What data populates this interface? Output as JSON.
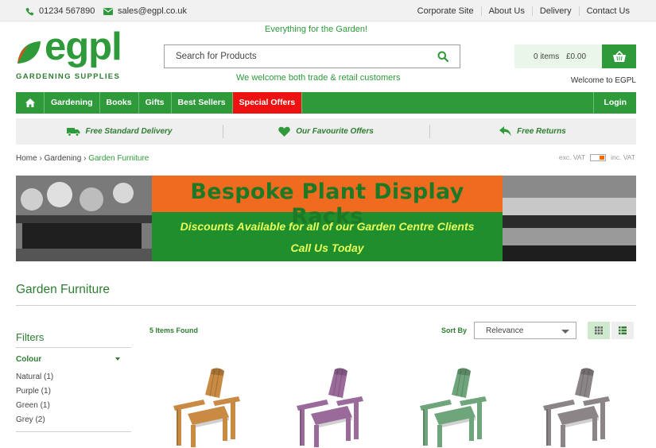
{
  "topbar": {
    "phone": "01234 567890",
    "email": "sales@egpl.co.uk",
    "links": [
      "Corporate Site",
      "About Us",
      "Delivery",
      "Contact Us"
    ]
  },
  "header": {
    "logo_text": "egpl",
    "logo_sub": "GARDENING SUPPLIES",
    "tagline": "Everything for the Garden!",
    "search_placeholder": "Search for Products",
    "welcome_trade": "We welcome both trade & retail customers",
    "basket_items": "0 items",
    "basket_total": "£0.00",
    "welcome_user": "Welcome to EGPL"
  },
  "nav": {
    "items": [
      "Gardening",
      "Books",
      "Gifts",
      "Best Sellers",
      "Special Offers"
    ],
    "login": "Login"
  },
  "usp": [
    "Free Standard Delivery",
    "Our Favourite Offers",
    "Free Returns"
  ],
  "breadcrumb": {
    "home": "Home",
    "sep": "›",
    "level1": "Gardening",
    "current": "Garden Furniture"
  },
  "vat": {
    "exc": "exc. VAT",
    "inc": "inc. VAT"
  },
  "banner": {
    "headline": "Bespoke Plant Display Racks",
    "line2": "Discounts Available for all of our Garden Centre Clients",
    "line3": "Call Us Today"
  },
  "page": {
    "title": "Garden Furniture"
  },
  "filters": {
    "title": "Filters",
    "colour_title": "Colour",
    "options": [
      "Natural (1)",
      "Purple (1)",
      "Green (1)",
      "Grey (2)"
    ]
  },
  "results": {
    "found": "5 Items Found",
    "sort_label": "Sort By",
    "sort_value": "Relevance"
  },
  "products": [
    {
      "color": "#c98a43"
    },
    {
      "color": "#9a6b9a"
    },
    {
      "color": "#6fa57b"
    },
    {
      "color": "#8c8588"
    }
  ],
  "colors": {
    "brand": "#2e9a3a",
    "offer": "#ee1111",
    "banner_orange": "#f06b1f"
  }
}
